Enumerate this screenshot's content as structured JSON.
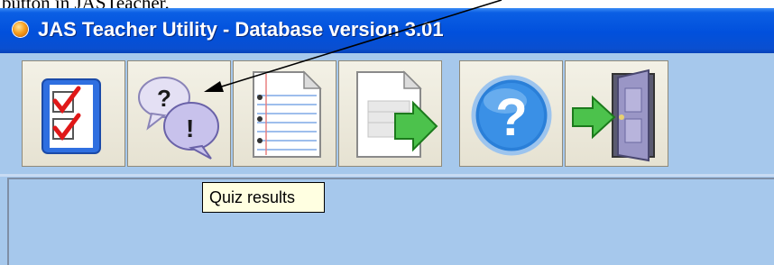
{
  "caption": {
    "text": "button in JASTeacher."
  },
  "window": {
    "title": "JAS Teacher Utility - Database version 3.01",
    "title_icon": "orange-orb-icon"
  },
  "toolbar": {
    "buttons": [
      {
        "id": "checklist",
        "icon": "checklist-icon"
      },
      {
        "id": "quiz-results",
        "icon": "question-answer-bubbles-icon",
        "tooltip": "Quiz results"
      },
      {
        "id": "notepad",
        "icon": "notepad-icon"
      },
      {
        "id": "export",
        "icon": "export-document-icon"
      },
      {
        "id": "help",
        "icon": "help-icon"
      },
      {
        "id": "exit",
        "icon": "exit-door-icon"
      }
    ]
  },
  "tooltip": {
    "text": "Quiz results"
  },
  "colors": {
    "titlebar": "#0150dc",
    "workspace": "#a6c8ec",
    "tooltip_bg": "#ffffe1",
    "button_face": "#ece9d8"
  }
}
